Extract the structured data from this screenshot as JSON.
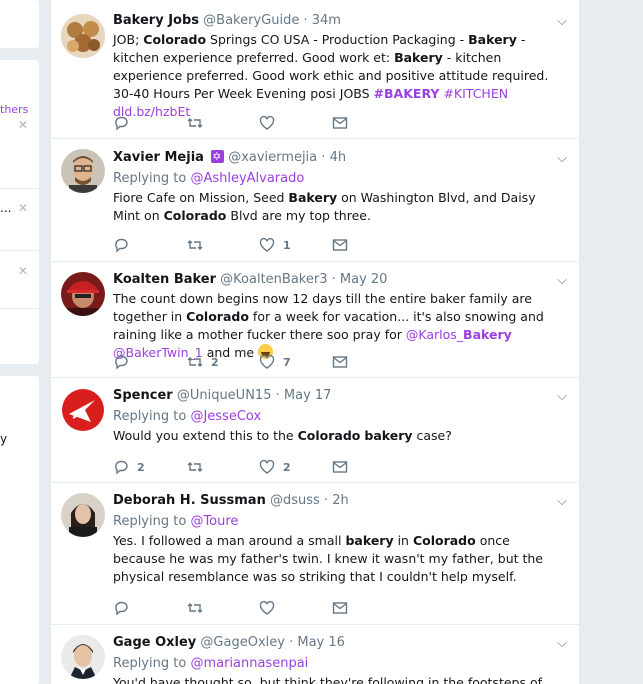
{
  "sidebar": {
    "fragments": [
      "thers",
      "...",
      "y"
    ]
  },
  "tweets": [
    {
      "name": "Bakery Jobs",
      "handle": "@BakeryGuide",
      "time": "34m",
      "text_parts": [
        {
          "t": "JOB; "
        },
        {
          "t": "Colorado",
          "s": "b"
        },
        {
          "t": " Springs CO USA - Production Packaging - "
        },
        {
          "t": "Bakery",
          "s": "b"
        },
        {
          "t": " - kitchen experience preferred. Good work et: "
        },
        {
          "t": "Bakery",
          "s": "b"
        },
        {
          "t": " - kitchen experience preferred. Good work ethic and positive attitude required. 30-40 Hours Per Week Evening posi JOBS "
        },
        {
          "t": "#BAKERY",
          "s": "pb"
        },
        {
          "t": " "
        },
        {
          "t": "#KITCHEN",
          "s": "p"
        },
        {
          "t": " "
        },
        {
          "t": "dld.bz/hzbEt",
          "s": "p"
        }
      ],
      "reply": "",
      "retweets": "",
      "likes": ""
    },
    {
      "name": "Xavier Mejia",
      "handle": "@xaviermejia",
      "time": "4h",
      "reply_prefix": "Replying to",
      "reply": "@AshleyAlvarado",
      "text_parts": [
        {
          "t": "Fiore Cafe on Mission, Seed "
        },
        {
          "t": "Bakery",
          "s": "b"
        },
        {
          "t": " on Washington Blvd, and Daisy Mint on "
        },
        {
          "t": "Colorado",
          "s": "b"
        },
        {
          "t": " Blvd are my top three."
        }
      ],
      "replies": "",
      "retweets": "",
      "likes": "1"
    },
    {
      "name": "Koalten Baker",
      "handle": "@KoaltenBaker3",
      "time": "May 20",
      "text_parts": [
        {
          "t": "The count down begins now 12 days till the entire baker family are together in "
        },
        {
          "t": "Colorado",
          "s": "b"
        },
        {
          "t": " for a week for vacation... it's also snowing and raining like a mother fucker there soo pray for "
        },
        {
          "t": "@Karlos_",
          "s": "p"
        },
        {
          "t": "Bakery",
          "s": "pb"
        },
        {
          "t": " "
        },
        {
          "t": "@BakerTwin_1",
          "s": "p"
        },
        {
          "t": " and me "
        },
        {
          "t": "",
          "s": "emoji"
        }
      ],
      "replies": "",
      "retweets": "2",
      "likes": "7"
    },
    {
      "name": "Spencer",
      "handle": "@UniqueUN15",
      "time": "May 17",
      "reply_prefix": "Replying to",
      "reply": "@JesseCox",
      "text_parts": [
        {
          "t": "Would you extend this to the "
        },
        {
          "t": "Colorado",
          "s": "b"
        },
        {
          "t": " "
        },
        {
          "t": "bakery",
          "s": "b"
        },
        {
          "t": " case?"
        }
      ],
      "replies": "2",
      "retweets": "",
      "likes": "2"
    },
    {
      "name": "Deborah H. Sussman",
      "handle": "@dsuss",
      "time": "2h",
      "reply_prefix": "Replying to",
      "reply": "@Toure",
      "text_parts": [
        {
          "t": "Yes. I followed a man around a small "
        },
        {
          "t": "bakery",
          "s": "b"
        },
        {
          "t": " in "
        },
        {
          "t": "Colorado",
          "s": "b"
        },
        {
          "t": " once because he was my father's twin. I knew it wasn't my father, but the physical resemblance was so striking that I couldn't help myself."
        }
      ],
      "replies": "",
      "retweets": "",
      "likes": ""
    },
    {
      "name": "Gage Oxley",
      "handle": "@GageOxley",
      "time": "May 16",
      "reply_prefix": "Replying to",
      "reply": "@mariannasenpai",
      "text_parts": [
        {
          "t": "You'd have thought so, but think they're following in the footsteps of that famous"
        }
      ]
    }
  ],
  "colors": {
    "accent": "#9c3fe0",
    "muted": "#657786",
    "background": "#e6ecf0"
  }
}
